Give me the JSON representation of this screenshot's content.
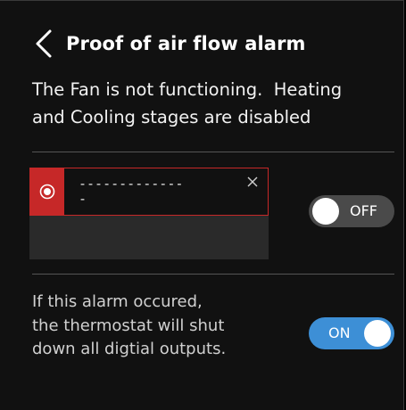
{
  "header": {
    "back_icon": "chevron-left-icon",
    "title": "Proof of air flow alarm"
  },
  "description": {
    "line1": "The Fan is not functioning.  Heating",
    "line2": "and Cooling stages are disabled"
  },
  "alarm": {
    "status_icon": "alarm-record-icon",
    "text": "-------------",
    "text2": "-",
    "close_icon": "close-icon",
    "accent_color": "#c62828"
  },
  "alarm_toggle": {
    "state": "OFF",
    "label": "OFF"
  },
  "shutdown": {
    "line1": "If this alarm occured,",
    "line2": "the thermostat will shut",
    "line3": "down all digtial outputs."
  },
  "shutdown_toggle": {
    "state": "ON",
    "label": "ON",
    "accent_color": "#3d8fd6"
  }
}
